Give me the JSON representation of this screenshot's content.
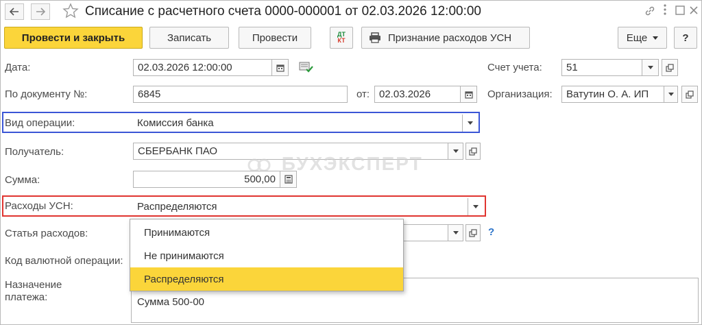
{
  "window": {
    "title": "Списание с расчетного счета 0000-000001 от 02.03.2026 12:00:00",
    "back_icon": "arrow-left-icon",
    "forward_icon": "arrow-right-icon"
  },
  "toolbar": {
    "post_close": "Провести и закрыть",
    "save": "Записать",
    "post": "Провести",
    "dtkt_top": "ДТ",
    "dtkt_bottom": "КТ",
    "usn_report": "Признание расходов УСН",
    "more": "Еще",
    "help": "?"
  },
  "form": {
    "date": {
      "label": "Дата:",
      "value": "02.03.2026 12:00:00"
    },
    "doc_number": {
      "label": "По документу №:",
      "value": "6845"
    },
    "doc_date": {
      "label": "от:",
      "value": "02.03.2026"
    },
    "account": {
      "label": "Счет учета:",
      "value": "51"
    },
    "organization": {
      "label": "Организация:",
      "value": "Ватутин О. А. ИП"
    },
    "operation_type": {
      "label": "Вид операции:",
      "value": "Комиссия банка"
    },
    "recipient": {
      "label": "Получатель:",
      "value": "СБЕРБАНК ПАО"
    },
    "amount": {
      "label": "Сумма:",
      "value": "500,00"
    },
    "usn_expenses": {
      "label": "Расходы УСН:",
      "value": "Распределяются"
    },
    "expense_item": {
      "label": "Статья расходов:",
      "value": ""
    },
    "currency_op_code": {
      "label": "Код валютной операции:"
    },
    "purpose": {
      "label_line1": "Назначение",
      "label_line2": "платежа:",
      "value": "Сумма 500-00"
    }
  },
  "dropdown": {
    "options": [
      "Принимаются",
      "Не принимаются",
      "Распределяются"
    ],
    "selected": "Распределяются"
  },
  "help_q": "?",
  "watermark": "БУХЭКСПЕРТ",
  "colors": {
    "primary": "#fbd53a",
    "highlight_blue": "#3a55d6",
    "highlight_red": "#e0342f"
  }
}
